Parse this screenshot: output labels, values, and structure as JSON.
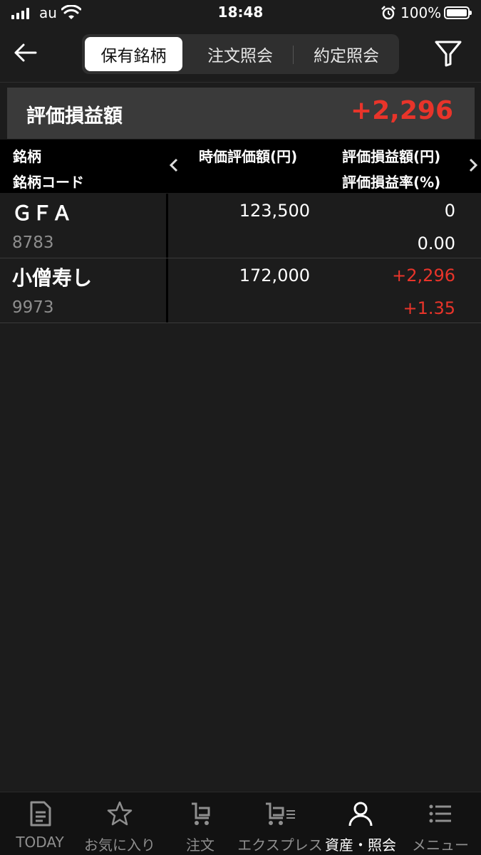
{
  "status_bar": {
    "carrier": "au",
    "time": "18:48",
    "battery": "100%"
  },
  "nav": {
    "tabs": [
      {
        "label": "保有銘柄",
        "active": true
      },
      {
        "label": "注文照会",
        "active": false
      },
      {
        "label": "約定照会",
        "active": false
      }
    ]
  },
  "summary": {
    "label": "評価損益額",
    "value": "+2,296"
  },
  "table": {
    "headers": {
      "name": "銘柄",
      "code": "銘柄コード",
      "market_value": "時価評価額(円)",
      "pl_amount": "評価損益額(円)",
      "pl_rate": "評価損益率(%)"
    },
    "rows": [
      {
        "name": "ＧＦＡ",
        "code": "8783",
        "market_value": "123,500",
        "pl_amount": "0",
        "pl_rate": "0.00"
      },
      {
        "name": "小僧寿し",
        "code": "9973",
        "market_value": "172,000",
        "pl_amount": "+2,296",
        "pl_rate": "+1.35"
      }
    ]
  },
  "tab_bar": {
    "items": [
      {
        "label": "TODAY",
        "icon": "news-icon"
      },
      {
        "label": "お気に入り",
        "icon": "star-icon"
      },
      {
        "label": "注文",
        "icon": "cart-icon"
      },
      {
        "label": "エクスプレス",
        "icon": "express-cart-icon"
      },
      {
        "label": "資産・照会",
        "icon": "person-icon"
      },
      {
        "label": "メニュー",
        "icon": "menu-list-icon"
      }
    ]
  },
  "colors": {
    "background": "#1c1c1c",
    "accent_red": "#e8342a",
    "header_bg": "#000000",
    "summary_bg": "#3a3a3a"
  }
}
